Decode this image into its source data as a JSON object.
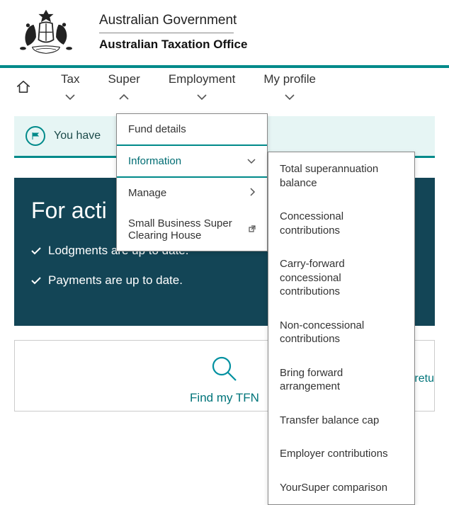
{
  "header": {
    "line1": "Australian Government",
    "line2": "Australian Taxation Office"
  },
  "nav": {
    "home": "Home",
    "items": [
      {
        "label": "Tax"
      },
      {
        "label": "Super"
      },
      {
        "label": "Employment"
      },
      {
        "label": "My profile"
      }
    ]
  },
  "notice": {
    "text_fragment": "You have "
  },
  "hero": {
    "title_fragment": "For acti",
    "line1": "Lodgments are up to date.",
    "line2": "Payments are up to date."
  },
  "tiles": {
    "find_tfn": "Find my TFN",
    "right_fragment": "x retu"
  },
  "dropdown": {
    "items": [
      {
        "label": "Fund details"
      },
      {
        "label": "Information"
      },
      {
        "label": "Manage"
      },
      {
        "label": "Small Business Super Clearing House"
      }
    ]
  },
  "submenu": {
    "items": [
      "Total superannuation balance",
      "Concessional contributions",
      "Carry-forward concessional contributions",
      "Non-concessional contributions",
      "Bring forward arrangement",
      "Transfer balance cap",
      "Employer contributions",
      "YourSuper comparison"
    ]
  }
}
